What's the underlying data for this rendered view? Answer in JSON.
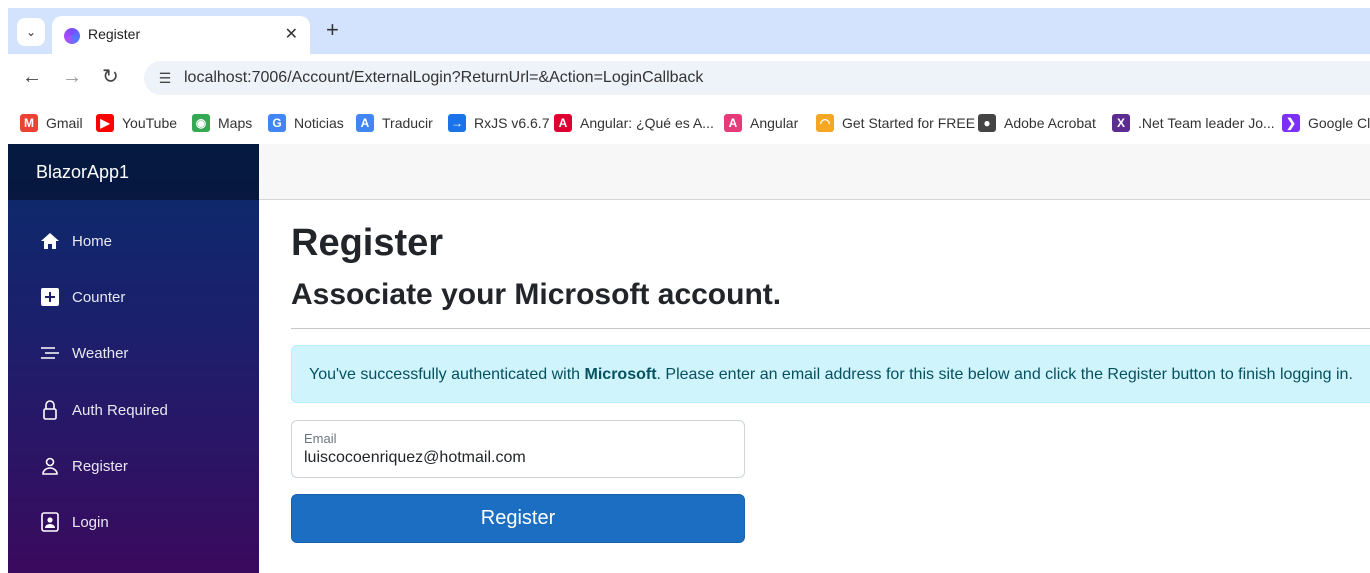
{
  "browser": {
    "tab_title": "Register",
    "tab_close": "✕",
    "new_tab": "+",
    "url": "localhost:7006/Account/ExternalLogin?ReturnUrl=&Action=LoginCallback",
    "bookmarks": [
      {
        "label": "Gmail",
        "icon": "gmail-icon",
        "color": "#ea4335",
        "glyph": "M"
      },
      {
        "label": "YouTube",
        "icon": "youtube-icon",
        "color": "#ff0000",
        "glyph": "▶"
      },
      {
        "label": "Maps",
        "icon": "maps-icon",
        "color": "#34a853",
        "glyph": "◉"
      },
      {
        "label": "Noticias",
        "icon": "google-icon",
        "color": "#4285f4",
        "glyph": "G"
      },
      {
        "label": "Traducir",
        "icon": "translate-icon",
        "color": "#4285f4",
        "glyph": "A"
      },
      {
        "label": "RxJS v6.6.7",
        "icon": "rxjs-icon",
        "color": "#1a73e8",
        "glyph": "→"
      },
      {
        "label": "Angular: ¿Qué es A...",
        "icon": "angular-icon",
        "color": "#dd0031",
        "glyph": "A"
      },
      {
        "label": "Angular",
        "icon": "angular-icon",
        "color": "#e53b7a",
        "glyph": "A"
      },
      {
        "label": "Get Started for FREE",
        "icon": "rainbow-icon",
        "color": "#f5a623",
        "glyph": "◠"
      },
      {
        "label": "Adobe Acrobat",
        "icon": "acrobat-icon",
        "color": "#444444",
        "glyph": "●"
      },
      {
        "label": ".Net Team leader Jo...",
        "icon": "dotnet-icon",
        "color": "#5c2d91",
        "glyph": "X"
      },
      {
        "label": "Google Cl",
        "icon": "chevron-icon",
        "color": "#7b2ff7",
        "glyph": "❯"
      }
    ]
  },
  "app": {
    "brand": "BlazorApp1",
    "nav": [
      {
        "label": "Home",
        "icon": "home-icon"
      },
      {
        "label": "Counter",
        "icon": "plus-square-icon"
      },
      {
        "label": "Weather",
        "icon": "list-icon"
      },
      {
        "label": "Auth Required",
        "icon": "lock-icon"
      },
      {
        "label": "Register",
        "icon": "person-icon"
      },
      {
        "label": "Login",
        "icon": "person-badge-icon"
      }
    ],
    "colors": {
      "accent": "#1b6ec2",
      "alert_bg": "#cff4fc",
      "alert_text": "#055160"
    }
  },
  "page": {
    "title": "Register",
    "subtitle": "Associate your Microsoft account.",
    "alert_prefix": "You've successfully authenticated with ",
    "alert_provider": "Microsoft",
    "alert_suffix": ". Please enter an email address for this site below and click the Register button to finish logging in.",
    "email_label": "Email",
    "email_value": "luiscocoenriquez@hotmail.com",
    "submit_label": "Register"
  }
}
